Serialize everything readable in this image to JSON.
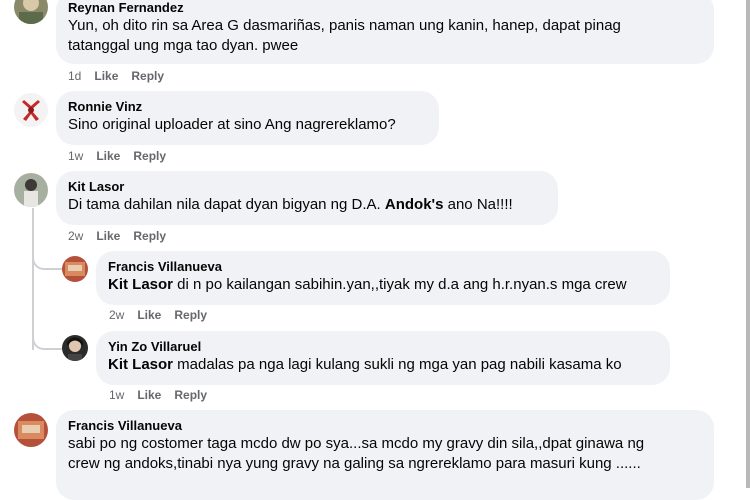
{
  "comments": [
    {
      "author": "Reynan Fernandez",
      "lines": [
        "Yun, oh dito rin sa Area G dasmariñas, panis naman ung kanin, hanep, dapat pinag",
        "tatanggal ung mga tao dyan. pwee"
      ],
      "time": "1d",
      "like": "Like",
      "reply": "Reply"
    },
    {
      "author": "Ronnie Vinz",
      "lines": [
        "Sino original uploader at sino Ang nagrereklamo?"
      ],
      "time": "1w",
      "like": "Like",
      "reply": "Reply"
    },
    {
      "author": "Kit Lasor",
      "text_before": "Di tama dahilan nila dapat dyan bigyan ng D.A. ",
      "text_bold": "Andok's",
      "text_after": " ano Na!!!!",
      "time": "2w",
      "like": "Like",
      "reply": "Reply"
    },
    {
      "author": "Francis Villanueva",
      "mention": "Kit Lasor",
      "text": " di n po kailangan sabihin.yan,,tiyak my d.a ang h.r.nyan.s mga crew",
      "time": "2w",
      "like": "Like",
      "reply": "Reply"
    },
    {
      "author": "Yin Zo Villaruel",
      "mention": "Kit Lasor",
      "text": " madalas pa nga lagi kulang sukli ng mga yan pag nabili kasama ko",
      "time": "1w",
      "like": "Like",
      "reply": "Reply"
    },
    {
      "author": "Francis Villanueva",
      "lines": [
        "sabi po ng costomer taga mcdo dw po sya...sa mcdo my gravy din sila,,dpat ginawa ng",
        "crew ng andoks,tinabi nya yung gravy na galing sa ngrereklamo para masuri kung ......"
      ]
    }
  ],
  "colors": {
    "bubble": "#f0f2f5",
    "secondary_text": "#65676b",
    "thread_line": "#ced0d4"
  }
}
